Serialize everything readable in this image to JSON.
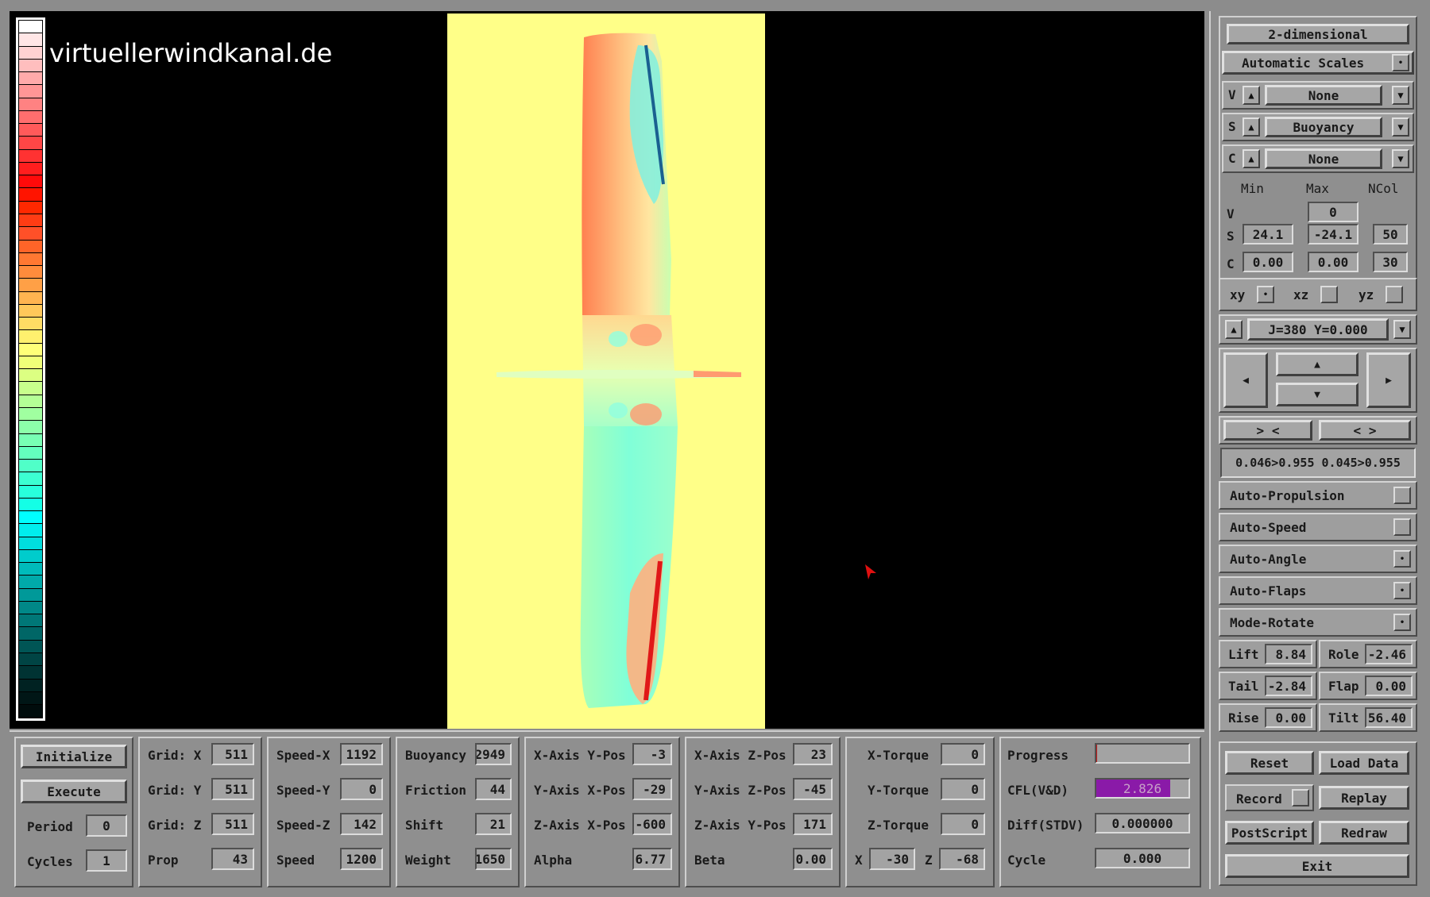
{
  "watermark": "virtuellerwindkanal.de",
  "colors": {
    "background": "#000000",
    "panel": "#8c8c8c",
    "plot_bg": "#ffff88",
    "cfl_bar": "#8a1aa8",
    "cursor": "#e01010"
  },
  "colorbar": {
    "steps": [
      "#ffffff",
      "#ffe6e6",
      "#ffd2d2",
      "#ffbebe",
      "#ffaaaa",
      "#ff9696",
      "#ff8282",
      "#ff6e6e",
      "#ff5a5a",
      "#ff4646",
      "#ff3232",
      "#ff1e1e",
      "#ff0a0a",
      "#ff1400",
      "#ff2800",
      "#ff3c14",
      "#ff5028",
      "#ff6428",
      "#ff7832",
      "#ff8c3c",
      "#ffa046",
      "#ffb450",
      "#ffc85a",
      "#ffdc64",
      "#fff06e",
      "#ffff78",
      "#f0ff78",
      "#dcff82",
      "#c8ff8c",
      "#b4ff96",
      "#a0ffa0",
      "#8cffaa",
      "#78ffb4",
      "#64ffbe",
      "#50ffc8",
      "#3cffd2",
      "#28ffdc",
      "#14ffe6",
      "#00ffff",
      "#00eeee",
      "#00dede",
      "#00cccc",
      "#00bbbb",
      "#00aaaa",
      "#009999",
      "#008888",
      "#007777",
      "#006666",
      "#005555",
      "#004444",
      "#003333",
      "#002222",
      "#001616",
      "#000c0c"
    ]
  },
  "right": {
    "mode_button": "2-dimensional",
    "auto_scales": "Automatic Scales",
    "v_label": "V",
    "v_select": "None",
    "s_label": "S",
    "s_select": "Buoyancy",
    "c_label": "C",
    "c_select": "None",
    "headers": {
      "min": "Min",
      "max": "Max",
      "ncol": "NCol"
    },
    "v_row": {
      "label": "V",
      "max": "0"
    },
    "s_row": {
      "label": "S",
      "min": "24.1",
      "max": "-24.1",
      "ncol": "50"
    },
    "c_row": {
      "label": "C",
      "min": "0.00",
      "max": "0.00",
      "ncol": "30"
    },
    "planes": {
      "xy": "xy",
      "xz": "xz",
      "yz": "yz"
    },
    "slice": "J=380  Y=0.000",
    "zoom_in": "> <",
    "zoom_out": "< >",
    "window": "0.046>0.955 0.045>0.955",
    "toggles": [
      "Auto-Propulsion",
      "Auto-Speed",
      "Auto-Angle",
      "Auto-Flaps",
      "Mode-Rotate"
    ],
    "toggle_states": [
      false,
      false,
      true,
      true,
      true
    ],
    "lift": {
      "label": "Lift",
      "value": "8.84"
    },
    "role": {
      "label": "Role",
      "value": "-2.46"
    },
    "tail": {
      "label": "Tail",
      "value": "-2.84"
    },
    "flap": {
      "label": "Flap",
      "value": "0.00"
    },
    "rise": {
      "label": "Rise",
      "value": "0.00"
    },
    "tilt": {
      "label": "Tilt",
      "value": "56.40"
    },
    "reset": "Reset",
    "load_data": "Load Data",
    "record": "Record",
    "replay": "Replay",
    "postscript": "PostScript",
    "redraw": "Redraw",
    "exit": "Exit"
  },
  "bottom": {
    "initialize": "Initialize",
    "execute": "Execute",
    "period": {
      "label": "Period",
      "value": "0"
    },
    "cycles": {
      "label": "Cycles",
      "value": "1"
    },
    "grid_x": {
      "label": "Grid: X",
      "value": "511"
    },
    "grid_y": {
      "label": "Grid: Y",
      "value": "511"
    },
    "grid_z": {
      "label": "Grid: Z",
      "value": "511"
    },
    "prop": {
      "label": "Prop",
      "value": "43"
    },
    "speed_x": {
      "label": "Speed-X",
      "value": "1192"
    },
    "speed_y": {
      "label": "Speed-Y",
      "value": "0"
    },
    "speed_z": {
      "label": "Speed-Z",
      "value": "142"
    },
    "speed": {
      "label": "Speed",
      "value": "1200"
    },
    "buoyancy": {
      "label": "Buoyancy",
      "value": "2949"
    },
    "friction": {
      "label": "Friction",
      "value": "44"
    },
    "shift": {
      "label": "Shift",
      "value": "21"
    },
    "weight": {
      "label": "Weight",
      "value": "1650"
    },
    "xaxis_ypos": {
      "label": "X-Axis Y-Pos",
      "value": "-3"
    },
    "yaxis_xpos": {
      "label": "Y-Axis X-Pos",
      "value": "-29"
    },
    "zaxis_xpos": {
      "label": "Z-Axis X-Pos",
      "value": "-600"
    },
    "alpha": {
      "label": "Alpha",
      "value": "6.77"
    },
    "xaxis_zpos": {
      "label": "X-Axis Z-Pos",
      "value": "23"
    },
    "yaxis_zpos": {
      "label": "Y-Axis Z-Pos",
      "value": "-45"
    },
    "zaxis_ypos": {
      "label": "Z-Axis Y-Pos",
      "value": "171"
    },
    "beta": {
      "label": "Beta",
      "value": "0.00"
    },
    "x_torque": {
      "label": "X-Torque",
      "value": "0"
    },
    "y_torque": {
      "label": "Y-Torque",
      "value": "0"
    },
    "z_torque": {
      "label": "Z-Torque",
      "value": "0"
    },
    "x_small": {
      "label": "X",
      "value": "-30"
    },
    "z_small": {
      "label": "Z",
      "value": "-68"
    },
    "progress": {
      "label": "Progress",
      "fraction": 0.01
    },
    "cfl": {
      "label": "CFL(V&D)",
      "value": "2.826",
      "fraction": 0.8
    },
    "diff": {
      "label": "Diff(STDV)",
      "value": "0.000000"
    },
    "cycle": {
      "label": "Cycle",
      "value": "0.000"
    }
  }
}
